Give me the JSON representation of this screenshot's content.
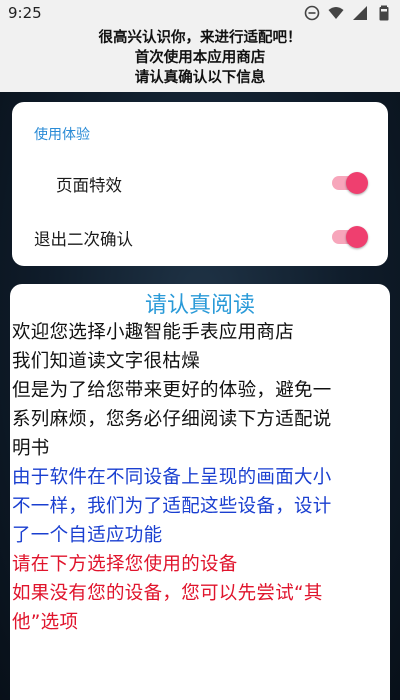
{
  "status_bar": {
    "time": "9:25",
    "icons": [
      "do-not-disturb-icon",
      "wifi-icon",
      "signal-icon",
      "battery-icon"
    ]
  },
  "header": {
    "lines": [
      "很高兴认识你，来进行适配吧！",
      "首次使用本应用商店",
      "请认真确认以下信息"
    ]
  },
  "settings": {
    "section_title": "使用体验",
    "items": [
      {
        "label": "页面特效",
        "enabled": true
      },
      {
        "label": "退出二次确认",
        "enabled": true
      }
    ],
    "colors": {
      "accent": "#2a8bd6",
      "toggle_on": "#ef3f6f"
    }
  },
  "reading": {
    "title": "请认真阅读",
    "paragraphs": [
      {
        "color": "#111111",
        "lines": [
          "欢迎您选择小趣智能手表应用商店"
        ]
      },
      {
        "color": "#111111",
        "lines": [
          "我们知道读文字很枯燥"
        ]
      },
      {
        "color": "#111111",
        "lines": [
          "但是为了给您带来更好的体验，避免一",
          "系列麻烦，您务必仔细阅读下方适配说",
          "明书"
        ]
      },
      {
        "color": "#1a3fd0",
        "lines": [
          "由于软件在不同设备上呈现的画面大小",
          "不一样，我们为了适配这些设备，设计",
          "了一个自适应功能"
        ]
      },
      {
        "color": "#e0142c",
        "lines": [
          "请在下方选择您使用的设备"
        ]
      },
      {
        "color": "#e0142c",
        "lines": [
          "如果没有您的设备，您可以先尝试“其",
          "他”选项"
        ]
      }
    ]
  }
}
